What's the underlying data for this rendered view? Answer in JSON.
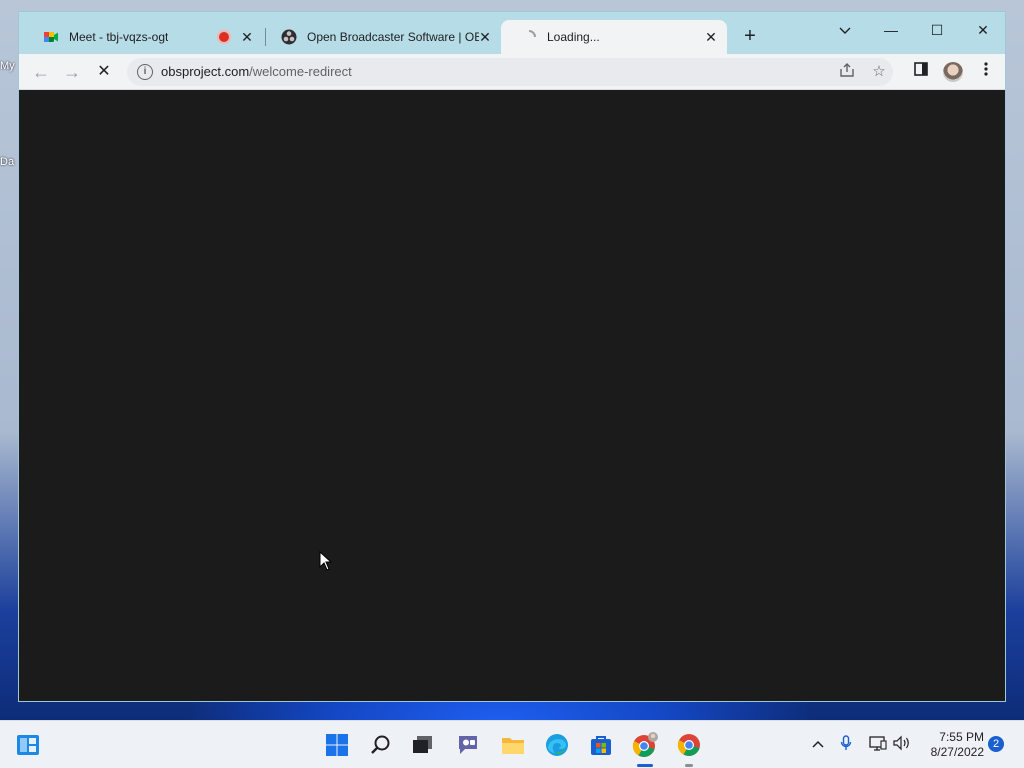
{
  "desktop": {
    "icon_labels": [
      "My",
      "Da"
    ]
  },
  "browser": {
    "tabs": [
      {
        "title": "Meet - tbj-vqzs-ogt",
        "favicon": "google-meet-icon",
        "recording": true,
        "active": false
      },
      {
        "title": "Open Broadcaster Software | OBS",
        "favicon": "obs-icon",
        "recording": false,
        "active": false
      },
      {
        "title": "Loading...",
        "favicon": "loading-icon",
        "recording": false,
        "active": true
      }
    ],
    "new_tab_symbol": "+",
    "tab_search_symbol": "⌄",
    "window_controls": {
      "minimize": "—",
      "maximize": "☐",
      "close": "✕"
    },
    "toolbar": {
      "back": "←",
      "forward": "→",
      "stop": "✕",
      "url_domain": "obsproject.com",
      "url_path": "/welcome-redirect",
      "info": "i"
    },
    "content_background": "#1b1b1b"
  },
  "taskbar": {
    "clock_time": "7:55 PM",
    "clock_date": "8/27/2022",
    "notification_count": "2",
    "apps": [
      "start-icon",
      "search-icon",
      "task-view-icon",
      "teams-chat-icon",
      "file-explorer-icon",
      "edge-icon",
      "store-icon",
      "chrome-profile-icon",
      "chrome-icon"
    ],
    "tray": [
      "chevron-up-icon",
      "microphone-icon",
      "network-icon",
      "volume-icon"
    ]
  },
  "colors": {
    "tabstrip": "#b6dce8",
    "toolbar": "#f1f3f4",
    "accent_blue": "#1a5fd0"
  }
}
